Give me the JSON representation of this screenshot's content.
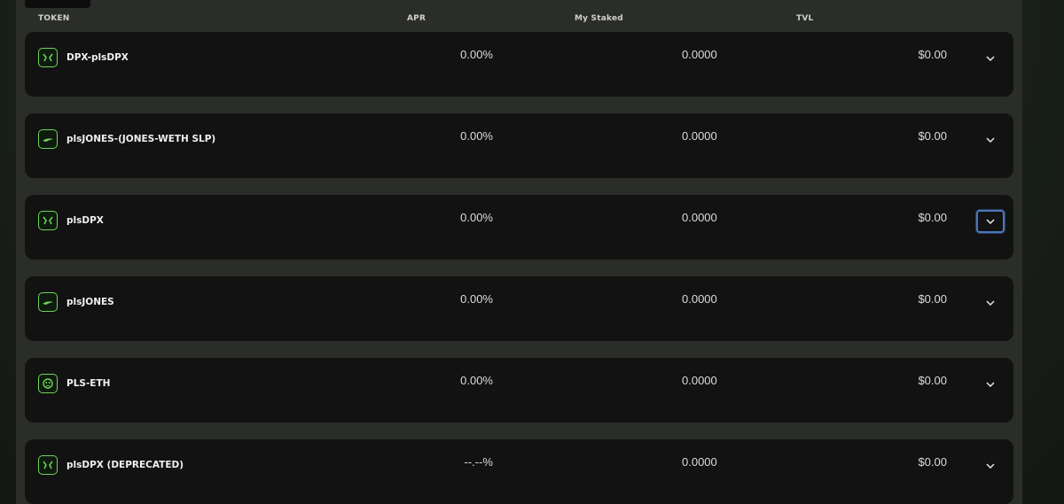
{
  "table": {
    "headers": {
      "token": "TOKEN",
      "apr": "APR",
      "staked": "My Staked",
      "tvl": "TVL"
    },
    "rows": [
      {
        "name": "DPX-plsDPX",
        "apr": "0.00%",
        "staked": "0.0000",
        "tvl": "$0.00",
        "icon": "dpx-logo-icon",
        "expanded_focus": false
      },
      {
        "name": "plsJONES-(JONES-WETH SLP)",
        "apr": "0.00%",
        "staked": "0.0000",
        "tvl": "$0.00",
        "icon": "jones-logo-icon",
        "expanded_focus": false
      },
      {
        "name": "plsDPX",
        "apr": "0.00%",
        "staked": "0.0000",
        "tvl": "$0.00",
        "icon": "dpx-logo-icon",
        "expanded_focus": true
      },
      {
        "name": "plsJONES",
        "apr": "0.00%",
        "staked": "0.0000",
        "tvl": "$0.00",
        "icon": "jones-logo-icon",
        "expanded_focus": false
      },
      {
        "name": "PLS-ETH",
        "apr": "0.00%",
        "staked": "0.0000",
        "tvl": "$0.00",
        "icon": "pls-logo-icon",
        "expanded_focus": false
      },
      {
        "name": "plsDPX (DEPRECATED)",
        "apr": "--.--%",
        "staked": "0.0000",
        "tvl": "$0.00",
        "icon": "dpx-logo-icon",
        "expanded_focus": false
      }
    ]
  },
  "colors": {
    "accent_green": "#6ed45a",
    "row_bg": "#121212",
    "panel_bg": "#2a2d28",
    "focus_blue": "#4a78b8"
  }
}
